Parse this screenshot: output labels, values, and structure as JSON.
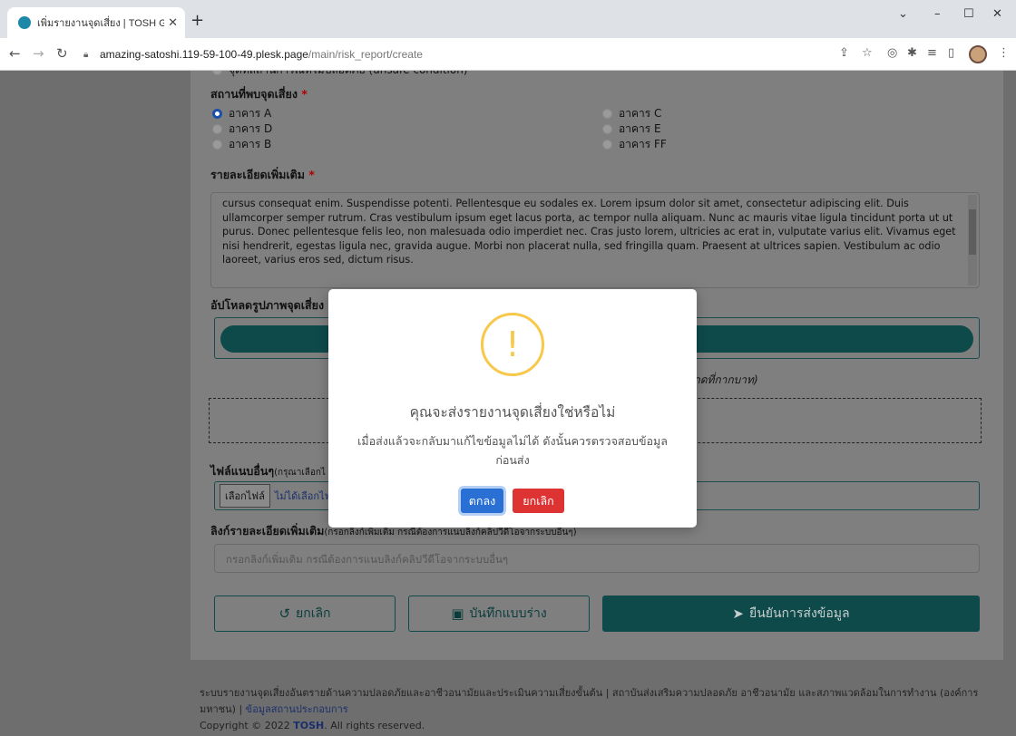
{
  "browser": {
    "tab_title": "เพิ่มรายงานจุดเสี่ยง | TOSH Good Ca",
    "tab_close": "✕",
    "new_tab": "+",
    "url_host": "amazing-satoshi.119-59-100-49.plesk.page",
    "url_path": "/main/risk_report/create",
    "window_controls": {
      "menu": "⌄",
      "minimize": "–",
      "maximize": "☐",
      "close": "✕"
    }
  },
  "form": {
    "partial_option": "จุดที่สถานการณ์ที่ไม่ปลอดภัย (unsafe condition)",
    "location_label": "สถานที่พบจุดเสี่ยง",
    "required_mark": "*",
    "locations": [
      {
        "label": "อาคาร A",
        "checked": true
      },
      {
        "label": "อาคาร D",
        "checked": false
      },
      {
        "label": "อาคาร B",
        "checked": false
      },
      {
        "label": "อาคาร C",
        "checked": false
      },
      {
        "label": "อาคาร E",
        "checked": false
      },
      {
        "label": "อาคาร FF",
        "checked": false
      }
    ],
    "detail_label": "รายละเอียดเพิ่มเติม",
    "detail_text": "cursus consequat enim. Suspendisse potenti. Pellentesque eu sodales ex. Lorem ipsum dolor sit amet, consectetur adipiscing elit. Duis ullamcorper semper rutrum. Cras vestibulum ipsum eget lacus porta, ac tempor nulla aliquam. Nunc ac mauris vitae ligula tincidunt porta ut ut purus. Donec pellentesque felis leo, non malesuada odio imperdiet nec. Cras justo lorem, ultricies ac erat in, vulputate varius elit. Vivamus eget nisi hendrerit, egestas ligula nec, gravida augue. Morbi non placerat nulla, sed fringilla quam. Praesent at ultrices sapien. Vestibulum ac odio laoreet, varius eros sed, dictum risus.",
    "upload_label": "อัปโหลดรูปภาพจุดเสี่ยง",
    "upload_hint": "รกดที่กากบาท)",
    "other_files_label": "ไฟล์แนบอื่นๆ",
    "other_files_note": "(กรุณาเลือกไ",
    "choose_file": "เลือกไฟล์",
    "no_file": "ไม่ได้เลือกไฟล์",
    "link_label": "ลิงก์รายละเอียดเพิ่มเติม",
    "link_note": "(กรอกลิงก์เพิ่มเติม กรณีต้องการแนบลิงก์คลิปวีดีโอจากระบบอื่นๆ)",
    "link_placeholder": "กรอกลิงก์เพิ่มเติม กรณีต้องการแนบลิงก์คลิปวีดีโอจากระบบอื่นๆ",
    "btn_cancel": "ยกเลิก",
    "btn_draft": "บันทึกแบบร่าง",
    "btn_submit": "ยืนยันการส่งข้อมูล"
  },
  "footer": {
    "line1": "ระบบรายงานจุดเสี่ยงอันตรายด้านความปลอดภัยและอาชีวอนามัยและประเมินความเสี่ยงขั้นต้น | สถาบันส่งเสริมความปลอดภัย อาชีวอนามัย และสภาพแวดล้อมในการทำงาน (องค์การมหาชน) |",
    "link": "ข้อมูลสถานประกอบการ",
    "copyright_prefix": "Copyright © 2022",
    "brand": "TOSH",
    "copyright_suffix": ". All rights reserved."
  },
  "modal": {
    "icon": "!",
    "title": "คุณจะส่งรายงานจุดเสี่ยงใช่หรือไม่",
    "text": "เมื่อส่งแล้วจะกลับมาแก้ไขข้อมูลไม่ได้ ดังนั้นควรตรวจสอบข้อมูลก่อนส่ง",
    "ok": "ตกลง",
    "cancel": "ยกเลิก"
  }
}
